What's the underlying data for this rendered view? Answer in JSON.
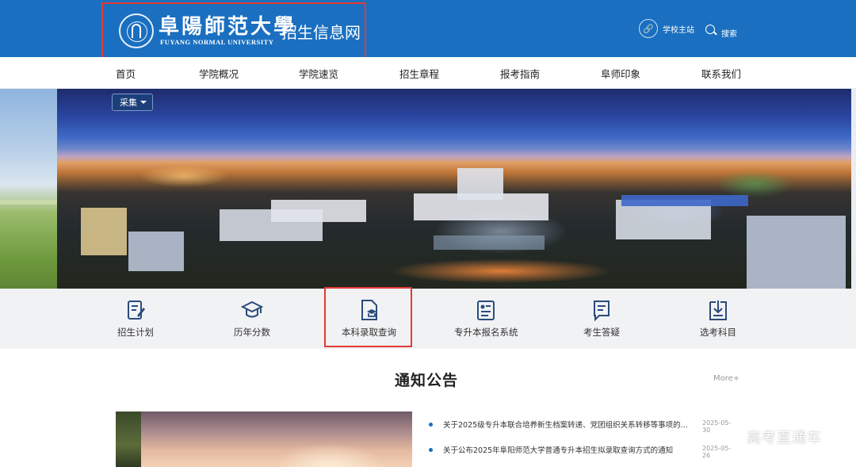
{
  "header": {
    "brand_cn": "阜陽師范大學",
    "brand_en": "FUYANG NORMAL UNIVERSITY",
    "site_name": "招生信息网",
    "school_link": "学校主站",
    "search_label": "搜索"
  },
  "nav": {
    "items": [
      "首页",
      "学院概况",
      "学院速览",
      "招生章程",
      "报考指南",
      "阜师印象",
      "联系我们"
    ]
  },
  "banner": {
    "dropdown_label": "采集"
  },
  "quick_links": {
    "items": [
      {
        "label": "招生计划",
        "icon": "plan-icon"
      },
      {
        "label": "历年分数",
        "icon": "graduation-cap-icon"
      },
      {
        "label": "本科录取查询",
        "icon": "admission-query-icon"
      },
      {
        "label": "专升本报名系统",
        "icon": "registration-system-icon"
      },
      {
        "label": "考生答疑",
        "icon": "qa-icon"
      },
      {
        "label": "选考科目",
        "icon": "download-subjects-icon"
      }
    ]
  },
  "notices": {
    "title": "通知公告",
    "more": "More+",
    "items": [
      {
        "text": "关于2025级专升本联合培养新生档案转递、党团组织关系转移等事项的...",
        "date": "2025-05-30"
      },
      {
        "text": "关于公布2025年阜阳师范大学普通专升本招生拟录取查询方式的通知",
        "date": "2025-05-26"
      }
    ]
  },
  "watermark": "高考直通车",
  "colors": {
    "header_blue": "#1a6fc0",
    "highlight_red": "#e53935",
    "quick_bar_bg": "#f1f2f4"
  }
}
